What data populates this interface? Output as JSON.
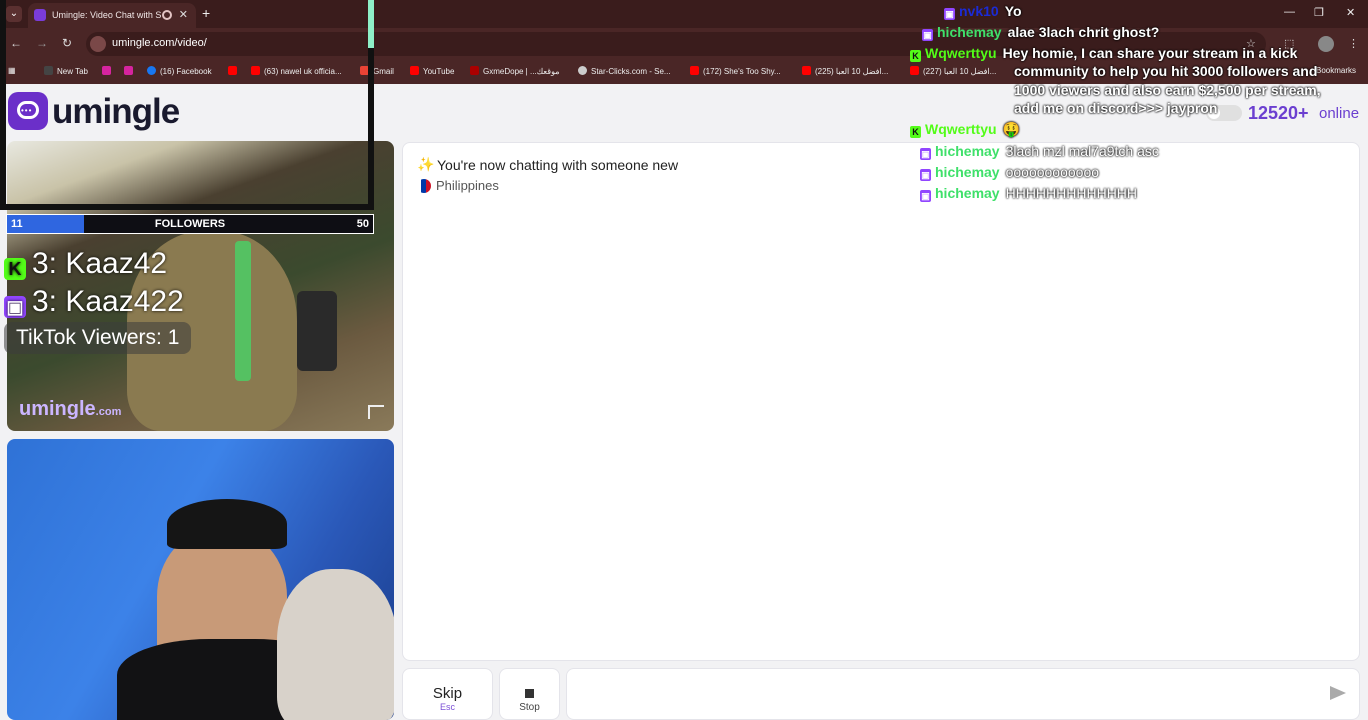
{
  "browser": {
    "tab_title": "Umingle: Video Chat with S",
    "url": "umingle.com/video/",
    "bookmarks": [
      "New Tab",
      "",
      "",
      "(16) Facebook",
      "",
      "(63) nawel uk officia...",
      "Gmail",
      "YouTube",
      "GxmeDope | ...موقعك",
      "Star-Clicks.com - Se...",
      "(172) She's Too Shy...",
      "(225) افضل 10 العبا...",
      "(227) افضل 10 العبا..."
    ],
    "bookmarks_extra": "Bookmarks"
  },
  "site": {
    "logo_text": "umingle",
    "watermark": "umingle",
    "watermark_tld": ".com",
    "online_count": "12520+",
    "online_label": "online"
  },
  "chat": {
    "status_message": "You're now chatting with someone new",
    "country": "Philippines",
    "skip_label": "Skip",
    "skip_shortcut": "Esc",
    "stop_label": "Stop",
    "input_value": ""
  },
  "overlay": {
    "followers_min": "11",
    "followers_label": "FOLLOWERS",
    "followers_max": "50",
    "followers_progress": 0.21,
    "kick_count": "3: Kaaz42",
    "twitch_count": "3: Kaaz422",
    "tiktok_viewers": "TikTok Viewers: 1",
    "stream_chat": [
      {
        "platform": "twitch",
        "user": "nvk10",
        "color": "#1b2bd6",
        "text": "Yo"
      },
      {
        "platform": "twitch",
        "user": "hichemay",
        "color": "#3fe06a",
        "text": "alae 3lach chrit ghost?"
      },
      {
        "platform": "kick",
        "user": "Wqwerttyu",
        "color": "#53fc18",
        "text": "Hey homie, I can share your stream in a kick"
      },
      {
        "platform": "kick",
        "user": "Wqwerttyu",
        "color": "#53fc18",
        "text": "🤑"
      },
      {
        "platform": "twitch",
        "user": "hichemay",
        "color": "#3fe06a",
        "text": "3lach mzl mal7a9tch asc"
      },
      {
        "platform": "twitch",
        "user": "hichemay",
        "color": "#3fe06a",
        "text": "oooooooooooo"
      },
      {
        "platform": "twitch",
        "user": "hichemay",
        "color": "#3fe06a",
        "text": "HHHHHHHHHHHHH"
      }
    ],
    "wrap_lines": [
      "community to help you hit 3000 followers and",
      "1000 viewers and also earn $2,500 per stream,",
      "add me on discord>>> jaypron"
    ]
  }
}
